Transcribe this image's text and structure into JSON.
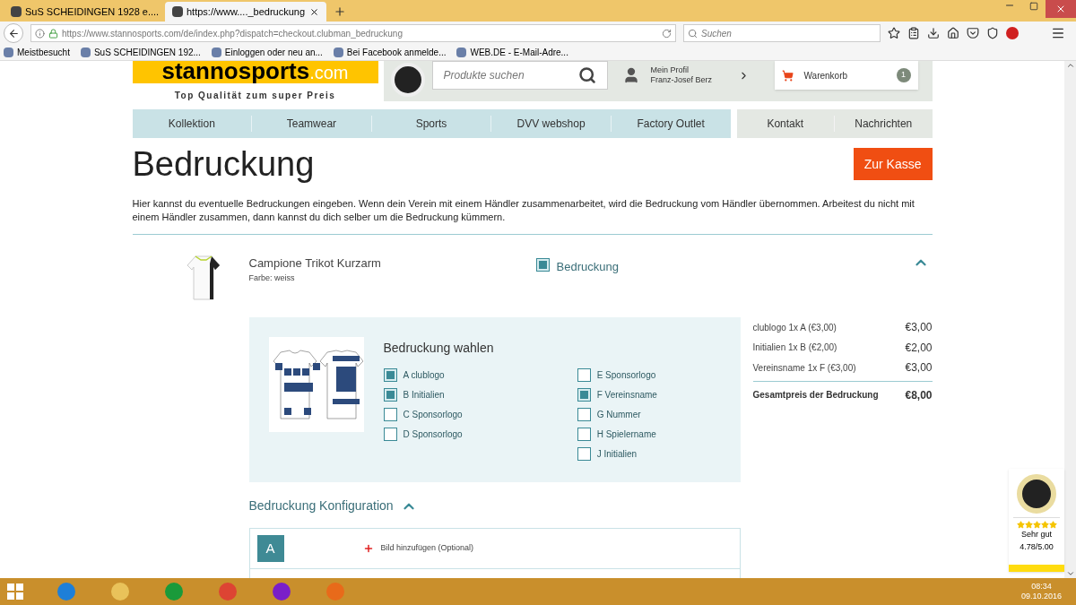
{
  "browser": {
    "tabs": [
      {
        "title": "SuS SCHEIDINGEN 1928 e....",
        "selected": false
      },
      {
        "title": "https://www...._bedruckung",
        "selected": true
      }
    ],
    "url": "https://www.stannosports.com/de/index.php?dispatch=checkout.clubman_bedruckung",
    "search_placeholder": "Suchen",
    "bookmarks": [
      "Meistbesucht",
      "SuS SCHEIDINGEN 192...",
      "Einloggen oder neu an...",
      "Bei Facebook anmelde...",
      "WEB.DE - E-Mail-Adre..."
    ]
  },
  "header": {
    "logo": "stannosports",
    "logo_suffix": ".com",
    "tagline": "Top Qualität zum super Preis",
    "search_placeholder": "Produkte suchen",
    "profile_label": "Mein Profil",
    "profile_name": "Franz-Josef Berz",
    "cart_label": "Warenkorb",
    "cart_count": "1"
  },
  "nav": {
    "main": [
      "Kollektion",
      "Teamwear",
      "Sports",
      "DVV webshop",
      "Factory Outlet"
    ],
    "secondary": [
      "Kontakt",
      "Nachrichten"
    ]
  },
  "page": {
    "title": "Bedruckung",
    "checkout_button": "Zur Kasse",
    "intro": "Hier kannst du eventuelle Bedruckungen eingeben. Wenn dein Verein mit einem Händler zusammenarbeitet, wird die Bedruckung vom Händler übernommen. Arbeitest du nicht mit einem Händler zusammen, dann kannst du dich selber um die Bedruckung kümmern."
  },
  "product": {
    "name": "Campione Trikot Kurzarm",
    "variant": "Farbe: weiss",
    "print_toggle": {
      "label": "Bedruckung",
      "checked": true
    },
    "expanded": true
  },
  "print_select": {
    "title": "Bedruckung wahlen",
    "options": [
      {
        "label": "A clublogo",
        "checked": true
      },
      {
        "label": "B Initialien",
        "checked": true
      },
      {
        "label": "C Sponsorlogo",
        "checked": false
      },
      {
        "label": "D Sponsorlogo",
        "checked": false
      },
      {
        "label": "E Sponsorlogo",
        "checked": false
      },
      {
        "label": "F Vereinsname",
        "checked": true
      },
      {
        "label": "G Nummer",
        "checked": false
      },
      {
        "label": "H Spielername",
        "checked": false
      },
      {
        "label": "J Initialien",
        "checked": false
      }
    ]
  },
  "summary": {
    "lines": [
      {
        "label": "clublogo 1x A (€3,00)",
        "price": "€3,00"
      },
      {
        "label": "Initialien 1x B (€2,00)",
        "price": "€2,00"
      },
      {
        "label": "Vereinsname 1x F (€3,00)",
        "price": "€3,00"
      }
    ],
    "total_label": "Gesamtpreis der Bedruckung",
    "total": "€8,00"
  },
  "configuration": {
    "title": "Bedruckung Konfiguration",
    "expanded": true,
    "rows": [
      {
        "letter": "A",
        "action": "Bild hinzufügen (Optional)"
      }
    ]
  },
  "trust_widget": {
    "stars": 5,
    "rating_text": "Sehr gut",
    "score": "4.78/5.00"
  },
  "taskbar": {
    "time": "08:34",
    "date": "09.10.2016"
  }
}
